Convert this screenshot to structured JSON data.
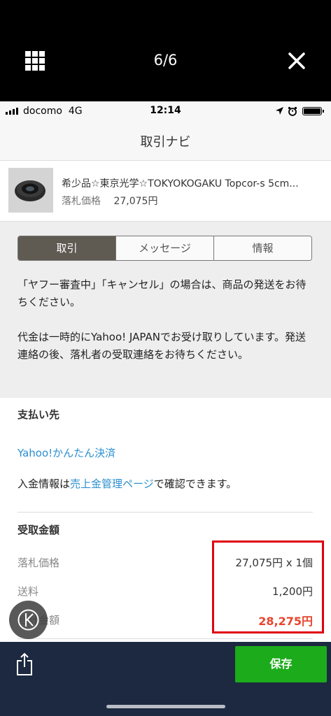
{
  "viewer": {
    "page_counter": "6/6"
  },
  "status_bar": {
    "carrier": "docomo",
    "network": "4G",
    "time": "12:14"
  },
  "nav": {
    "title": "取引ナビ"
  },
  "item": {
    "title": "希少品☆東京光学☆TOKYOKOGAKU Topcor-s 5cm...",
    "price_label": "落札価格",
    "price_value": "27,075円"
  },
  "tabs": [
    {
      "label": "取引",
      "active": true
    },
    {
      "label": "メッセージ",
      "active": false
    },
    {
      "label": "情報",
      "active": false
    }
  ],
  "notice": {
    "line1": "「ヤフー審査中」「キャンセル」の場合は、商品の発送をお待ちください。",
    "line2": "代金は一時的にYahoo! JAPANでお受け取りしています。発送連絡の後、落札者の受取連絡をお待ちください。"
  },
  "payment": {
    "section_title": "支払い先",
    "method_link": "Yahoo!かんたん決済",
    "info_prefix": "入金情報は",
    "info_link": "売上金管理ページ",
    "info_suffix": "で確認できます。"
  },
  "receipt": {
    "section_title": "受取金額",
    "rows": [
      {
        "label": "落札価格",
        "value": "27,075円 x 1個"
      },
      {
        "label": "送料",
        "value": "1,200円"
      },
      {
        "label": "合計金額",
        "value": "28,275円"
      }
    ]
  },
  "actions": {
    "save_label": "保存"
  },
  "colors": {
    "accent_green": "#1cab1a",
    "link_blue": "#2b8fd0",
    "total_red": "#e8452c",
    "highlight_red": "#e00010",
    "tab_active": "#5f5a52",
    "bottom_bar": "#1c2941"
  },
  "icons": [
    "grid-icon",
    "close-icon",
    "location-icon",
    "alarm-icon",
    "battery-icon",
    "assistive-touch-icon",
    "share-icon"
  ]
}
